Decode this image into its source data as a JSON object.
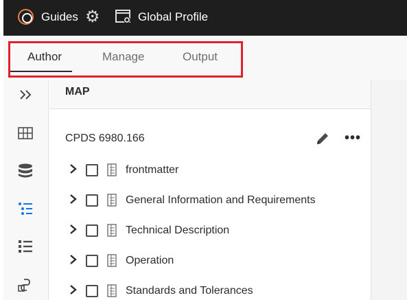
{
  "topbar": {
    "app_title": "Guides",
    "profile_title": "Global Profile",
    "icons": [
      "app-logo-icon",
      "gear-icon",
      "profile-settings-icon"
    ]
  },
  "tabs": {
    "items": [
      {
        "label": "Author",
        "active": true
      },
      {
        "label": "Manage",
        "active": false
      },
      {
        "label": "Output",
        "active": false
      }
    ]
  },
  "rail": {
    "icons": [
      "expand-icon",
      "grid-icon",
      "database-icon",
      "toc-icon",
      "list-icon",
      "link-icon"
    ],
    "active": "toc-icon"
  },
  "panel": {
    "title": "MAP",
    "map_name": "CPDS 6980.166",
    "rows": [
      {
        "label": "frontmatter"
      },
      {
        "label": "General Information and Requirements"
      },
      {
        "label": "Technical Description"
      },
      {
        "label": "Operation"
      },
      {
        "label": "Standards and Tolerances"
      }
    ]
  },
  "colors": {
    "topbar_bg": "#1e1e1e",
    "highlight": "#e0202a",
    "active_icon": "#1473e6",
    "logo": "#e8804d"
  }
}
